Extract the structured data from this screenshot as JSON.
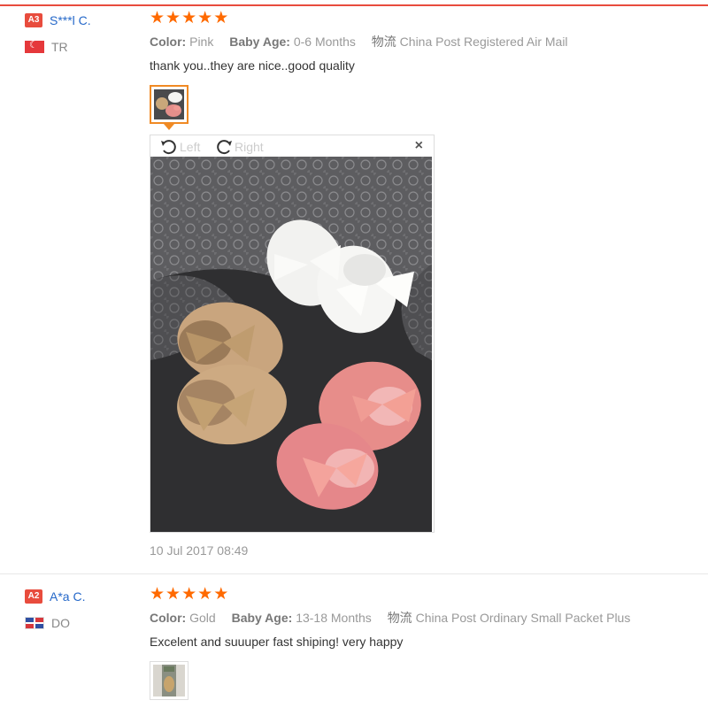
{
  "reviews": [
    {
      "level": "A3",
      "user": "S***l C.",
      "country": "TR",
      "stars": [
        "★",
        "★",
        "★",
        "★",
        "★"
      ],
      "attrs": {
        "color_key": "Color:",
        "color_val": "Pink",
        "age_key": "Baby Age:",
        "age_val": "0-6 Months",
        "ship_key": "物流",
        "ship_val": "China Post Registered Air Mail"
      },
      "text": "thank you..they are nice..good quality",
      "viewer": {
        "rotate_left": "Left",
        "rotate_right": "Right",
        "close": "×"
      },
      "date": "10 Jul 2017 08:49"
    },
    {
      "level": "A2",
      "user": "A*a C.",
      "country": "DO",
      "stars": [
        "★",
        "★",
        "★",
        "★",
        "★"
      ],
      "attrs": {
        "color_key": "Color:",
        "color_val": "Gold",
        "age_key": "Baby Age:",
        "age_val": "13-18 Months",
        "ship_key": "物流",
        "ship_val": "China Post Ordinary Small Packet Plus"
      },
      "text": "Excelent and suuuper fast shiping! very happy"
    }
  ],
  "colors": {
    "accent": "#e84c3d",
    "star": "#ff6a00",
    "username": "#2568c9",
    "thumb_active": "#f08a24"
  }
}
